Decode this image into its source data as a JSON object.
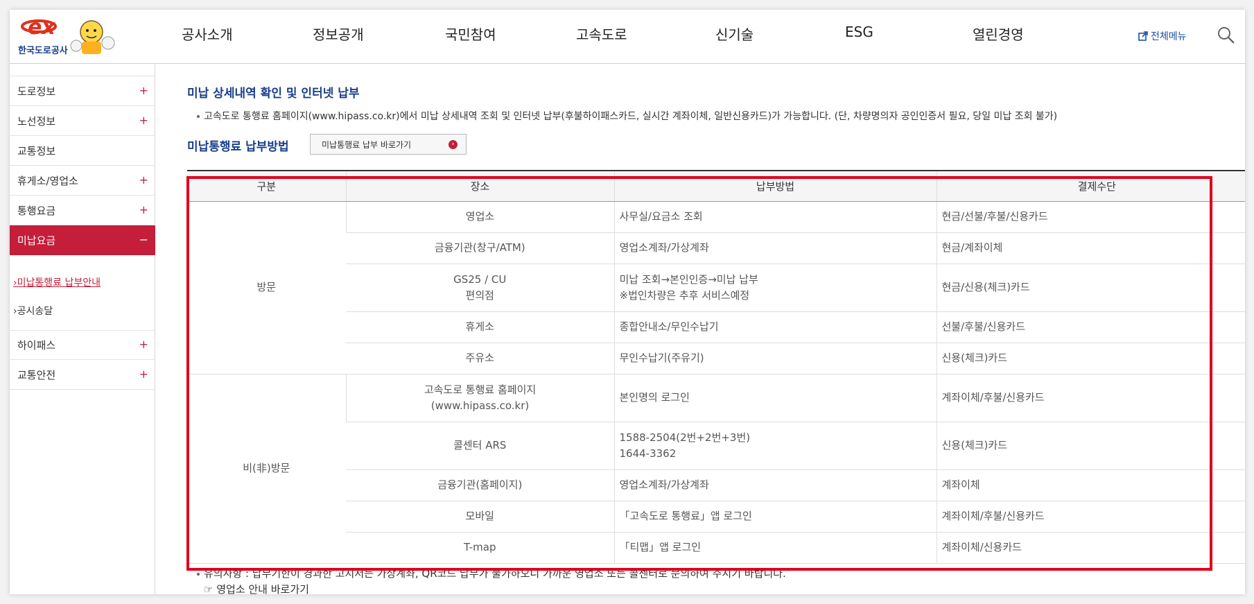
{
  "header": {
    "logo_text": "한국도로공사",
    "nav": [
      "공사소개",
      "정보공개",
      "국민참여",
      "고속도로",
      "신기술",
      "ESG",
      "열린경영"
    ],
    "all_menu_label": "전체메뉴",
    "colors": {
      "brand_red": "#c41e3a",
      "brand_blue": "#1a3e8c"
    }
  },
  "sidebar": {
    "items": [
      {
        "label": "도로정보",
        "icon": "+"
      },
      {
        "label": "노선정보",
        "icon": "+"
      },
      {
        "label": "교통정보",
        "icon": ""
      },
      {
        "label": "휴게소/영업소",
        "icon": "+"
      },
      {
        "label": "통행요금",
        "icon": "+"
      },
      {
        "label": "미납요금",
        "icon": "−"
      },
      {
        "label": "하이패스",
        "icon": "+"
      },
      {
        "label": "교통안전",
        "icon": "+"
      }
    ],
    "sub_items": [
      "미납통행료 납부안내",
      "공시송달"
    ]
  },
  "main": {
    "section1_title": "미납 상세내역 확인 및 인터넷 납부",
    "section1_note": "고속도로 통행료 홈페이지(www.hipass.co.kr)에서 미납 상세내역 조회 및 인터넷 납부(후불하이패스카드, 실시간 계좌이체, 일반신용카드)가 가능합니다. (단, 차량명의자 공인인증서 필요, 당일 미납 조회 불가)",
    "section2_title": "미납통행료 납부방법",
    "go_button_label": "미납통행료 납부 바로가기",
    "table": {
      "headers": [
        "구분",
        "장소",
        "납부방법",
        "결제수단"
      ],
      "groups": [
        {
          "label": "방문",
          "rows": [
            {
              "place": "영업소",
              "method": "사무실/요금소 조회",
              "payment": "현금/선불/후불/신용카드"
            },
            {
              "place": "금융기관(창구/ATM)",
              "method": "영업소계좌/가상계좌",
              "payment": "현금/계좌이체"
            },
            {
              "place": "GS25 / CU",
              "place2": "편의점",
              "method": "미납 조회→본인인증→미납 납부",
              "method2": "※법인차량은 추후 서비스예정",
              "payment": "현금/신용(체크)카드"
            },
            {
              "place": "휴게소",
              "method": "종합안내소/무인수납기",
              "payment": "선불/후불/신용카드"
            },
            {
              "place": "주유소",
              "method": "무인수납기(주유기)",
              "payment": "신용(체크)카드"
            }
          ]
        },
        {
          "label": "비(非)방문",
          "rows": [
            {
              "place": "고속도로 통행료 홈페이지",
              "place2": "(www.hipass.co.kr)",
              "method": "본인명의 로그인",
              "payment": "계좌이체/후불/신용카드"
            },
            {
              "place": "콜센터 ARS",
              "method": "1588-2504(2번+2번+3번)",
              "method2": "1644-3362",
              "payment": "신용(체크)카드"
            },
            {
              "place": "금융기관(홈페이지)",
              "method": "영업소계좌/가상계좌",
              "payment": "계좌이체"
            },
            {
              "place": "모바일",
              "method": "「고속도로 통행료」앱 로그인",
              "payment": "계좌이체/후불/신용카드"
            },
            {
              "place": "T-map",
              "method": "「티맵」앱 로그인",
              "payment": "계좌이체/신용카드"
            }
          ]
        }
      ]
    },
    "bottom_note": "유의사항 : 납부기한이 경과한 고지서는 가상계좌, QR코드 납부가 불가하오니 가까운 영업소 또는 콜센터로 문의하여 주시기 바랍니다.",
    "bottom_link": "☞ 영업소 안내 바로가기"
  }
}
